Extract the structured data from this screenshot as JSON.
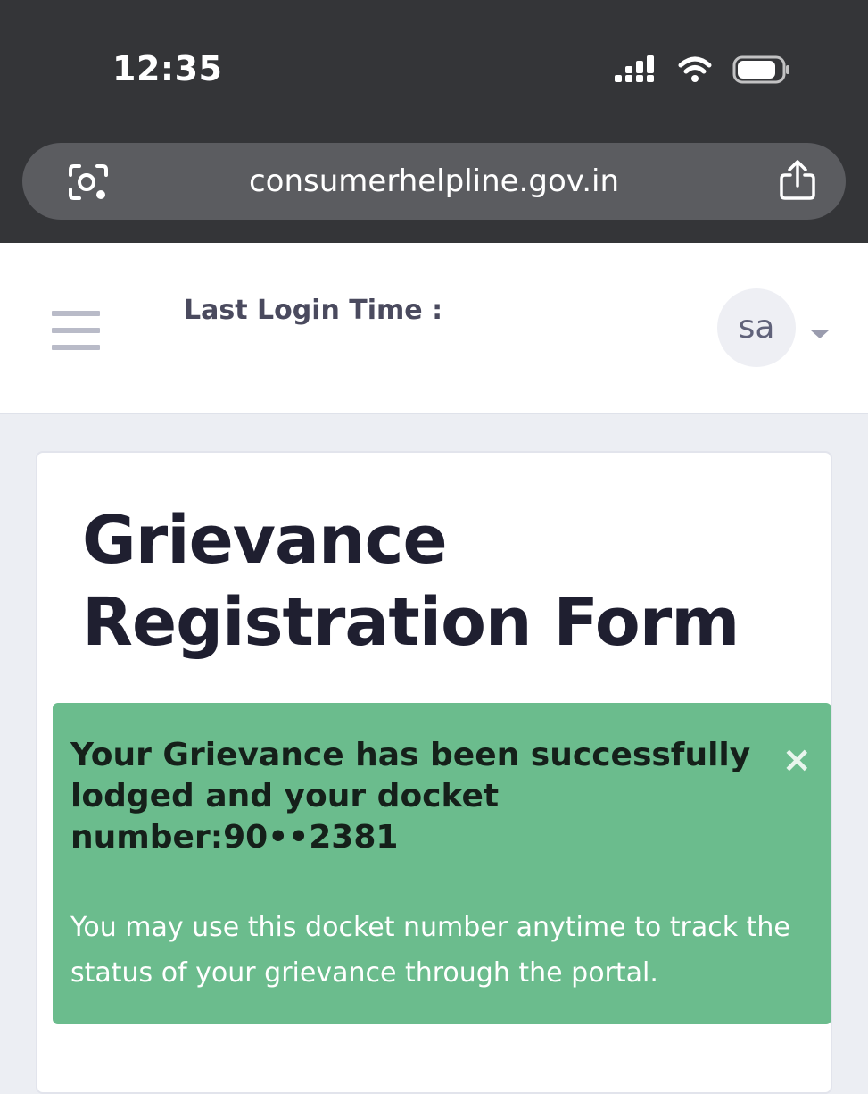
{
  "status_bar": {
    "time": "12:35",
    "icons": [
      "signal-icon",
      "wifi-icon",
      "battery-icon"
    ]
  },
  "browser": {
    "url": "consumerhelpline.gov.in",
    "icons": [
      "lens-icon",
      "share-icon"
    ]
  },
  "header": {
    "last_login_label": "Last Login Time :",
    "avatar_initials": "sa"
  },
  "form": {
    "title": "Grievance Registration Form"
  },
  "alert": {
    "heading": "Your Grievance has been successfully lodged and your docket number:90••2381",
    "close_glyph": "×",
    "body": "You may use this docket number anytime to track the status of your grievance through the portal."
  },
  "colors": {
    "chrome_bg": "#343538",
    "url_bar_bg": "#5b5c60",
    "page_bg": "#eceef3",
    "alert_bg": "#6bbc8d",
    "title_text": "#1f1f30"
  }
}
